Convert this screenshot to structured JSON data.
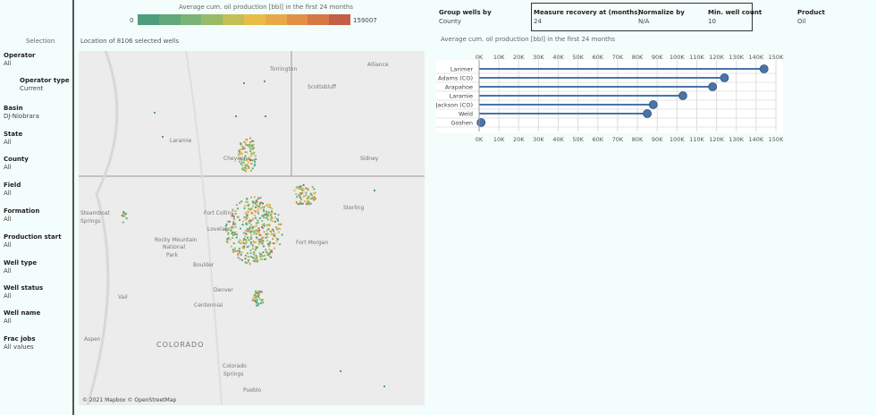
{
  "sidebar": {
    "title": "Selection",
    "filters": [
      {
        "label": "Operator",
        "value": "All"
      },
      {
        "label": "Operator type",
        "value": "Current"
      },
      {
        "label": "Basin",
        "value": "DJ-Niobrara"
      },
      {
        "label": "State",
        "value": "All"
      },
      {
        "label": "County",
        "value": "All"
      },
      {
        "label": "Field",
        "value": "All"
      },
      {
        "label": "Formation",
        "value": "All"
      },
      {
        "label": "Production start",
        "value": "All"
      },
      {
        "label": "Well type",
        "value": "All"
      },
      {
        "label": "Well status",
        "value": "All"
      },
      {
        "label": "Well name",
        "value": "All"
      },
      {
        "label": "Frac jobs",
        "value": "All values"
      }
    ]
  },
  "legend": {
    "title": "Average cum. oil production [bbl] in the first 24 months",
    "min": "0",
    "max": "159007",
    "colors": [
      "#4e9e7e",
      "#63a87a",
      "#7ab377",
      "#99ba68",
      "#c4bf55",
      "#e7bd48",
      "#e9a848",
      "#e29046",
      "#d67747",
      "#c45e45"
    ]
  },
  "map": {
    "caption": "Location of 8106 selected wells",
    "credit": "© 2021 Mapbox © OpenStreetMap",
    "places": [
      "Torrington",
      "Alliance",
      "Scottsbluff",
      "Laramie",
      "Cheyenne",
      "Sidney",
      "Steamboat",
      "Springs",
      "Fort Collins",
      "Loveland",
      "Sterling",
      "Rocky Mountain",
      "National",
      "Park",
      "Fort Morgan",
      "Boulder",
      "Denver",
      "Centennial",
      "Vail",
      "Aspen",
      "COLORADO",
      "Colorado",
      "Springs",
      "Pueblo"
    ]
  },
  "controls": {
    "group_label": "Group wells by",
    "group_value": "County",
    "recovery_label": "Measure recovery at (months)",
    "recovery_value": "24",
    "normalize_label": "Normalize by",
    "normalize_value": "N/A",
    "minwell_label": "Min. well count",
    "minwell_value": "10",
    "product_label": "Product",
    "product_value": "Oil"
  },
  "chart_data": {
    "type": "bar",
    "title": "Average cum. oil production [bbl] in the first 24 months",
    "categories": [
      "Larimer",
      "Adams (CO)",
      "Arapahoe",
      "Laramie",
      "Jackson (CO)",
      "Weld",
      "Goshen"
    ],
    "values": [
      144000,
      124000,
      118000,
      103000,
      88000,
      85000,
      1000
    ],
    "xlim": [
      0,
      150000
    ],
    "ticks": [
      "0K",
      "10K",
      "20K",
      "30K",
      "40K",
      "50K",
      "60K",
      "70K",
      "80K",
      "90K",
      "100K",
      "110K",
      "120K",
      "130K",
      "140K",
      "150K"
    ],
    "bar_color": "#4a74a8",
    "grid": true
  }
}
